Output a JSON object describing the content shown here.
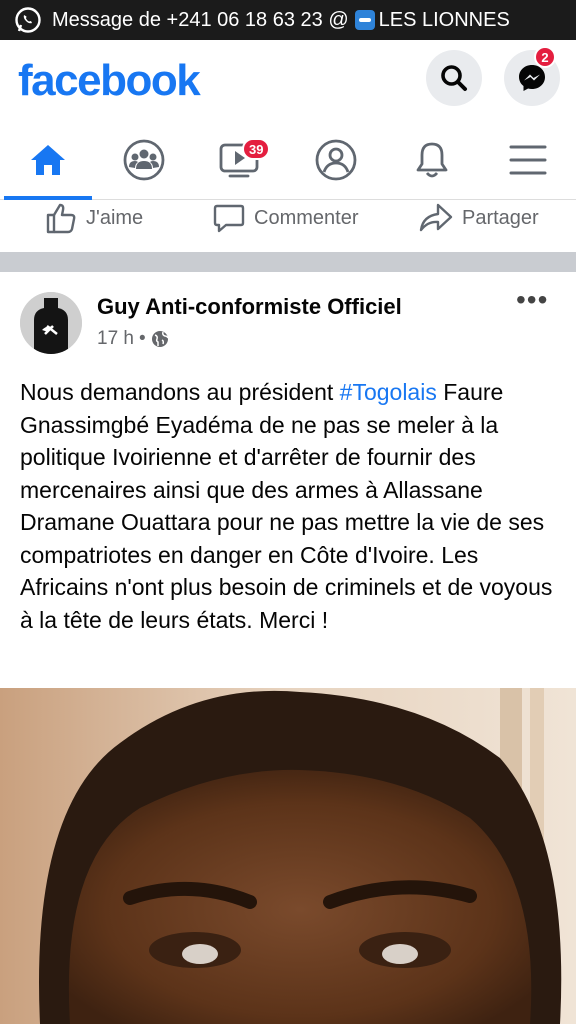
{
  "banner": {
    "text": "Message de +241 06 18 63 23 @",
    "channel": "LES LIONNES",
    "icon": "whatsapp-icon"
  },
  "header": {
    "logo": "facebook",
    "messenger_badge": "2",
    "search_icon": "search-icon",
    "messenger_icon": "messenger-icon"
  },
  "nav": {
    "tabs": [
      {
        "icon": "home-icon",
        "active": true
      },
      {
        "icon": "groups-icon"
      },
      {
        "icon": "watch-icon",
        "badge": "39"
      },
      {
        "icon": "profile-icon"
      },
      {
        "icon": "bell-icon"
      },
      {
        "icon": "menu-icon"
      }
    ]
  },
  "actions": {
    "like": "J'aime",
    "comment": "Commenter",
    "share": "Partager"
  },
  "post": {
    "author": "Guy Anti-conformiste Officiel",
    "time": "17 h",
    "dot": "•",
    "more": "•••",
    "text_before": "Nous demandons au président ",
    "hashtag": "#Togolais",
    "text_after": " Faure Gnassimgbé Eyadéma de ne pas se meler à la politique Ivoirienne et d'arrêter de fournir des mercenaires ainsi que des armes à Allassane Dramane Ouattara pour ne pas mettre la vie de ses compatriotes en danger en Côte d'Ivoire. Les Africains n'ont plus besoin de criminels et de voyous à la tête de leurs états. Merci !"
  },
  "colors": {
    "brand": "#1877f2",
    "badge": "#e41e3f",
    "banner_bg": "#1b1b1b"
  }
}
